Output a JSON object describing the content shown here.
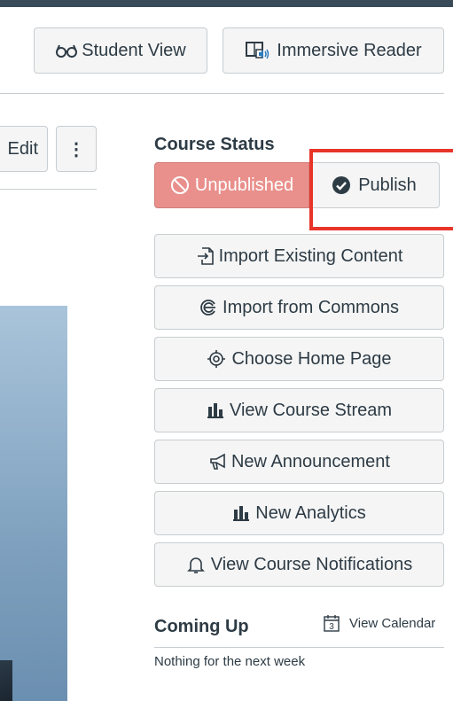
{
  "header": {
    "student_view_label": "Student View",
    "immersive_reader_label": "Immersive Reader"
  },
  "toolbar": {
    "edit_label": "Edit",
    "more_label": "⋮"
  },
  "course_status": {
    "heading": "Course Status",
    "unpublished_label": "Unpublished",
    "publish_label": "Publish"
  },
  "actions": [
    {
      "label": "Import Existing Content",
      "icon": "import-icon"
    },
    {
      "label": "Import from Commons",
      "icon": "commons-icon"
    },
    {
      "label": "Choose Home Page",
      "icon": "target-icon"
    },
    {
      "label": "View Course Stream",
      "icon": "bar-chart-icon"
    },
    {
      "label": "New Announcement",
      "icon": "megaphone-icon"
    },
    {
      "label": "New Analytics",
      "icon": "bar-chart-icon"
    },
    {
      "label": "View Course Notifications",
      "icon": "bell-icon"
    }
  ],
  "coming_up": {
    "heading": "Coming Up",
    "view_calendar_label": "View Calendar",
    "calendar_day": "3",
    "empty_text": "Nothing for the next week"
  },
  "colors": {
    "unpublished_bg": "#e9908c",
    "highlight_border": "#e8352a",
    "button_bg": "#f5f5f5",
    "text": "#2d3b45"
  }
}
